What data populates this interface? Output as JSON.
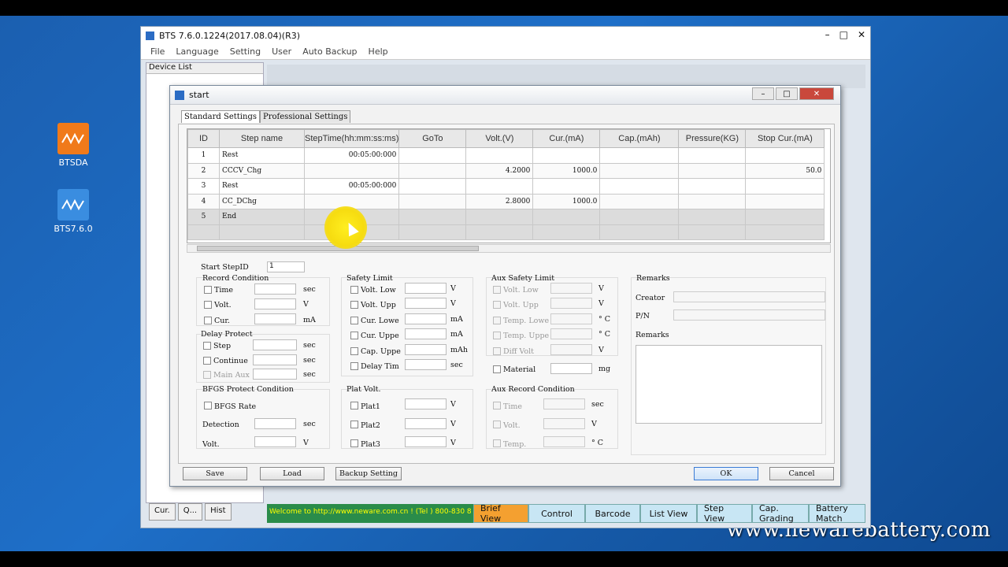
{
  "desktop": {
    "icons": [
      {
        "label": "BTSDA",
        "color": "#f07a1a"
      },
      {
        "label": "BTS7.6.0",
        "color": "#3a8de0"
      }
    ],
    "watermark": "www.newarebattery.com"
  },
  "app": {
    "title": "BTS 7.6.0.1224(2017.08.04)(R3)",
    "menu": [
      "File",
      "Language",
      "Setting",
      "User",
      "Auto Backup",
      "Help"
    ],
    "device_list_label": "Device List",
    "bottom_tabs": [
      "Cur.",
      "Q...",
      "Hist"
    ],
    "ticker": "Welcome to http://www.neware.com.cn !   (Tel ) 800-830 8",
    "status_buttons": [
      "Brief View",
      "Control",
      "Barcode",
      "List View",
      "Step View",
      "Cap. Grading",
      "Battery Match"
    ]
  },
  "dialog": {
    "title": "start",
    "tabs": [
      "Standard Settings",
      "Professional Settings"
    ],
    "grid": {
      "headers": [
        "ID",
        "Step name",
        "StepTime(hh:mm:ss:ms)",
        "GoTo",
        "Volt.(V)",
        "Cur.(mA)",
        "Cap.(mAh)",
        "Pressure(KG)",
        "Stop Cur.(mA)"
      ],
      "rows": [
        [
          "1",
          "Rest",
          "00:05:00:000",
          "",
          "",
          "",
          "",
          "",
          ""
        ],
        [
          "2",
          "CCCV_Chg",
          "",
          "",
          "4.2000",
          "1000.0",
          "",
          "",
          "50.0"
        ],
        [
          "3",
          "Rest",
          "00:05:00:000",
          "",
          "",
          "",
          "",
          "",
          ""
        ],
        [
          "4",
          "CC_DChg",
          "",
          "",
          "2.8000",
          "1000.0",
          "",
          "",
          ""
        ],
        [
          "5",
          "End",
          "",
          "",
          "",
          "",
          "",
          "",
          ""
        ]
      ]
    },
    "start_step": {
      "label": "Start StepID",
      "value": "1"
    },
    "record": {
      "title": "Record Condition",
      "items": [
        {
          "label": "Time",
          "unit": "sec"
        },
        {
          "label": "Volt.",
          "unit": "V"
        },
        {
          "label": "Cur.",
          "unit": "mA"
        }
      ]
    },
    "delay": {
      "title": "Delay Protect",
      "items": [
        {
          "label": "Step",
          "unit": "sec"
        },
        {
          "label": "Continue",
          "unit": "sec"
        },
        {
          "label": "Main Aux",
          "unit": "sec"
        }
      ]
    },
    "bfgs": {
      "title": "BFGS Protect Condition",
      "rate": "BFGS Rate",
      "detection": {
        "label": "Detection",
        "unit": "sec"
      },
      "volt": {
        "label": "Volt.",
        "unit": "V"
      }
    },
    "safety": {
      "title": "Safety Limit",
      "items": [
        {
          "label": "Volt. Low",
          "unit": "V"
        },
        {
          "label": "Volt. Upp",
          "unit": "V"
        },
        {
          "label": "Cur. Lowe",
          "unit": "mA"
        },
        {
          "label": "Cur. Uppe",
          "unit": "mA"
        },
        {
          "label": "Cap. Uppe",
          "unit": "mAh"
        },
        {
          "label": "Delay Tim",
          "unit": "sec"
        }
      ]
    },
    "plat": {
      "title": "Plat Volt.",
      "items": [
        {
          "label": "Plat1",
          "unit": "V"
        },
        {
          "label": "Plat2",
          "unit": "V"
        },
        {
          "label": "Plat3",
          "unit": "V"
        }
      ]
    },
    "aux_safety": {
      "title": "Aux Safety Limit",
      "items": [
        {
          "label": "Volt. Low",
          "unit": "V"
        },
        {
          "label": "Volt. Upp",
          "unit": "V"
        },
        {
          "label": "Temp. Lowe",
          "unit": "° C"
        },
        {
          "label": "Temp. Uppe",
          "unit": "° C"
        },
        {
          "label": "Diff Volt",
          "unit": "V"
        }
      ],
      "material": {
        "label": "Material",
        "unit": "mg"
      }
    },
    "aux_record": {
      "title": "Aux Record Condition",
      "items": [
        {
          "label": "Time",
          "unit": "sec"
        },
        {
          "label": "Volt.",
          "unit": "V"
        },
        {
          "label": "Temp.",
          "unit": "° C"
        }
      ]
    },
    "remarks": {
      "title": "Remarks",
      "creator": "Creator",
      "pn": "P/N",
      "remarks_label": "Remarks"
    },
    "buttons": {
      "save": "Save",
      "load": "Load",
      "backup": "Backup Setting",
      "ok": "OK",
      "cancel": "Cancel"
    }
  }
}
